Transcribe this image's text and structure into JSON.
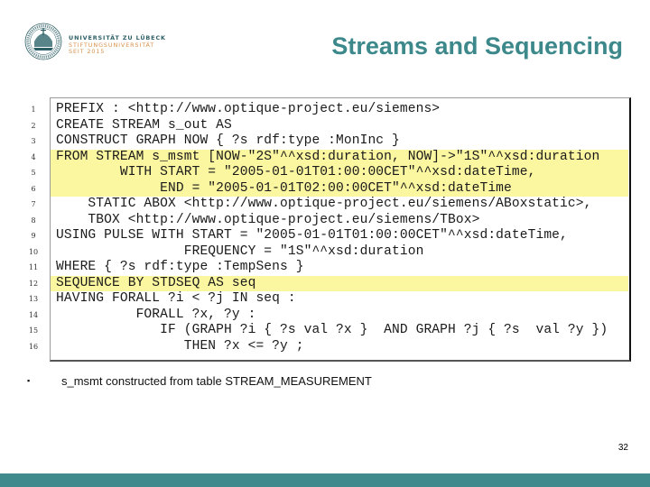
{
  "header": {
    "logo": {
      "line1": "UNIVERSITÄT ZU LÜBECK",
      "line2": "STIFTUNGSUNIVERSITÄT",
      "line3": "SEIT 2015",
      "seal_icon": "university-seal-icon"
    },
    "title": "Streams and Sequencing"
  },
  "code_listing": {
    "lines": [
      {
        "num": "1",
        "text": "PREFIX : <http://www.optique-project.eu/siemens>",
        "highlighted": false
      },
      {
        "num": "2",
        "text": "CREATE STREAM s_out AS",
        "highlighted": false
      },
      {
        "num": "3",
        "text": "CONSTRUCT GRAPH NOW { ?s rdf:type :MonInc }",
        "highlighted": false
      },
      {
        "num": "4",
        "text": "FROM STREAM s_msmt [NOW-\"2S\"^^xsd:duration, NOW]->\"1S\"^^xsd:duration",
        "highlighted": true
      },
      {
        "num": "5",
        "text": "        WITH START = \"2005-01-01T01:00:00CET\"^^xsd:dateTime,",
        "highlighted": true
      },
      {
        "num": "6",
        "text": "             END = \"2005-01-01T02:00:00CET\"^^xsd:dateTime",
        "highlighted": true
      },
      {
        "num": "7",
        "text": "    STATIC ABOX <http://www.optique-project.eu/siemens/ABoxstatic>,",
        "highlighted": false
      },
      {
        "num": "8",
        "text": "    TBOX <http://www.optique-project.eu/siemens/TBox>",
        "highlighted": false
      },
      {
        "num": "9",
        "text": "USING PULSE WITH START = \"2005-01-01T01:00:00CET\"^^xsd:dateTime,",
        "highlighted": false
      },
      {
        "num": "10",
        "text": "                FREQUENCY = \"1S\"^^xsd:duration",
        "highlighted": false
      },
      {
        "num": "11",
        "text": "WHERE { ?s rdf:type :TempSens }",
        "highlighted": false
      },
      {
        "num": "12",
        "text": "SEQUENCE BY STDSEQ AS seq",
        "highlighted": true
      },
      {
        "num": "13",
        "text": "HAVING FORALL ?i < ?j IN seq :",
        "highlighted": false
      },
      {
        "num": "14",
        "text": "          FORALL ?x, ?y :",
        "highlighted": false
      },
      {
        "num": "15",
        "text": "             IF (GRAPH ?i { ?s val ?x }  AND GRAPH ?j { ?s  val ?y })",
        "highlighted": false
      },
      {
        "num": "16",
        "text": "                THEN ?x <= ?y ;",
        "highlighted": false
      }
    ]
  },
  "bullets": [
    {
      "marker": "▪",
      "text": "s_msmt constructed from table STREAM_MEASUREMENT"
    }
  ],
  "footer": {
    "page_number": "32"
  },
  "colors": {
    "accent": "#3c888a",
    "footer_bar": "#3f8a8c",
    "highlight": "#fbf6a0",
    "logo_dark": "#2d5f66",
    "logo_orange": "#d9904a"
  }
}
